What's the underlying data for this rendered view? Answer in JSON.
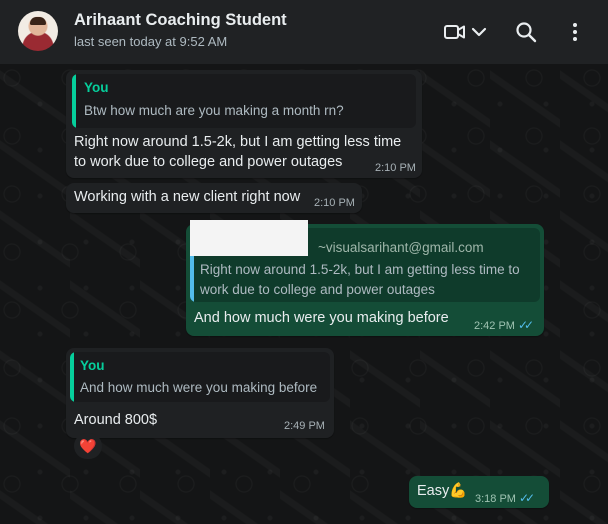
{
  "header": {
    "title": "Arihaant Coaching Student",
    "status": "last seen today at 9:52 AM"
  },
  "colors": {
    "incoming_bubble": "#202c33",
    "outgoing_bubble": "#144d37",
    "quote_accent": "#06cf9c",
    "read_ticks": "#53bdeb",
    "reaction_heart": "#e3344a"
  },
  "icons": {
    "video_call": "video-camera-icon",
    "dropdown": "chevron-down-icon",
    "search": "search-icon",
    "menu": "kebab-menu-icon",
    "read_receipt": "double-check-icon",
    "reaction": "heart-icon"
  },
  "messages": [
    {
      "direction": "in",
      "quote_author": "You",
      "quote_text": "Btw how much are you making a month rn?",
      "text_line1": "Right now around 1.5-2k, but I am getting less time",
      "text_line2": "to work due to college and power outages",
      "time": "2:10 PM"
    },
    {
      "direction": "in",
      "text": "Working with a new client right now",
      "time": "2:10 PM"
    },
    {
      "direction": "out",
      "quote_email": "~visualsarihant@gmail.com",
      "quote_line1": "Right now around 1.5-2k, but I am getting less time to",
      "quote_line2": "work due to college and power outages",
      "text": "And how much were you making before",
      "time": "2:42 PM",
      "ticks": "✓✓"
    },
    {
      "direction": "in",
      "quote_author": "You",
      "quote_text": "And how much were you making before",
      "text": "Around 800$",
      "time": "2:49 PM",
      "reaction": "❤️"
    },
    {
      "direction": "out",
      "text": "Easy💪",
      "time": "3:18 PM",
      "ticks": "✓✓"
    }
  ]
}
